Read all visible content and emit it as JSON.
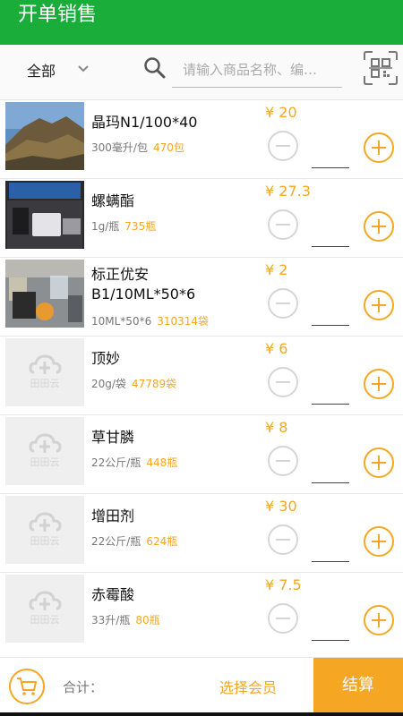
{
  "header": {
    "title": "开单销售"
  },
  "filter": {
    "category": "全部",
    "search_placeholder": "请输入商品名称、编…"
  },
  "items": [
    {
      "name": "晶玛N1/100*40",
      "spec": "300毫升/包",
      "stock": "470包",
      "price": "¥ 20",
      "image": "mountain-photo"
    },
    {
      "name": "螺螨酯",
      "spec": "1g/瓶",
      "stock": "735瓶",
      "price": "¥ 27.3",
      "image": "desk-photo"
    },
    {
      "name": "标正优安B1/10ML*50*6",
      "spec": "10ML*50*6",
      "stock": "310314袋",
      "price": "¥ 2",
      "image": "table-photo"
    },
    {
      "name": "顶妙",
      "spec": "20g/袋",
      "stock": "47789袋",
      "price": "¥ 6",
      "image": "placeholder-logo"
    },
    {
      "name": "草甘膦",
      "spec": "22公斤/瓶",
      "stock": "448瓶",
      "price": "¥ 8",
      "image": "placeholder-logo"
    },
    {
      "name": "增田剂",
      "spec": "22公斤/瓶",
      "stock": "624瓶",
      "price": "¥ 30",
      "image": "placeholder-logo"
    },
    {
      "name": "赤霉酸",
      "spec": "33升/瓶",
      "stock": "80瓶",
      "price": "¥ 7.5",
      "image": "placeholder-logo"
    }
  ],
  "placeholder_logo_text": "田田云",
  "footer": {
    "total_label": "合计：",
    "member_label": "选择会员",
    "checkout_label": "结算"
  },
  "colors": {
    "brand_green": "#1aad3a",
    "accent_orange": "#f5a623"
  }
}
